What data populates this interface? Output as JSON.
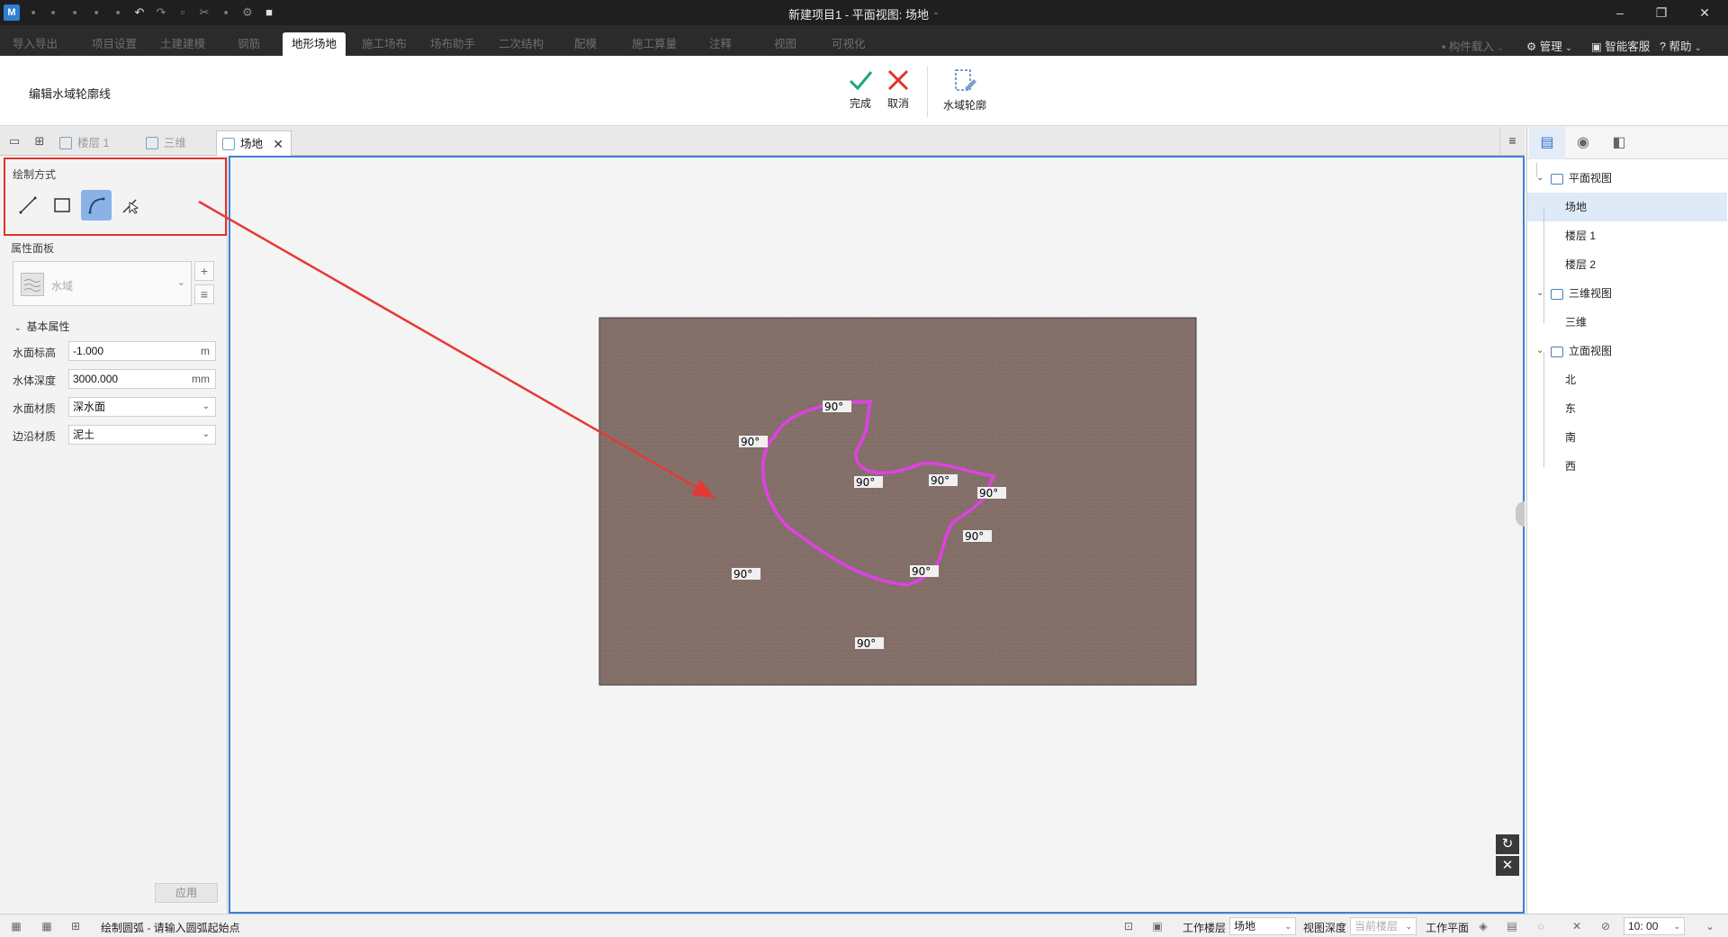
{
  "window": {
    "app_logo": "M",
    "title": "新建项目1 - 平面视图: 场地",
    "title_arrow": "⌃",
    "minimize": "–",
    "restore": "❐",
    "close": "✕"
  },
  "ribbon_tabs": [
    {
      "label": "导入导出"
    },
    {
      "label": "项目设置"
    },
    {
      "label": "土建建模"
    },
    {
      "label": "钢筋"
    },
    {
      "label": "地形场地"
    },
    {
      "label": "施工场布"
    },
    {
      "label": "场布助手"
    },
    {
      "label": "二次结构"
    },
    {
      "label": "配模"
    },
    {
      "label": "施工算量"
    },
    {
      "label": "注释"
    },
    {
      "label": "视图"
    },
    {
      "label": "可视化"
    }
  ],
  "ribbon_right": {
    "component_load": "构件载入",
    "manage": "管理",
    "smart_service": "智能客服",
    "help": "帮助"
  },
  "ribbon": {
    "mode_label": "编辑水域轮廓线",
    "finish": "完成",
    "cancel": "取消",
    "water_outline": "水域轮廓"
  },
  "view_tabs": [
    {
      "label": "楼层 1"
    },
    {
      "label": "三维"
    },
    {
      "label": "场地",
      "close": "✕"
    }
  ],
  "view_menu": "≡",
  "draw_mode": {
    "header": "绘制方式",
    "tools": [
      "line-tool",
      "rectangle-tool",
      "arc-tool",
      "pick-tool"
    ],
    "active_tool": "arc-tool"
  },
  "properties": {
    "header": "属性面板",
    "type_name": "水域",
    "add": "+",
    "edit": "≡",
    "group": "基本属性",
    "rows": [
      {
        "label": "水面标高",
        "value": "-1.000",
        "unit": "m"
      },
      {
        "label": "水体深度",
        "value": "3000.000",
        "unit": "mm"
      },
      {
        "label": "水面材质",
        "value": "深水面"
      },
      {
        "label": "边沿材质",
        "value": "泥土"
      }
    ],
    "apply": "应用"
  },
  "canvas": {
    "angle_labels": [
      "90°",
      "90°",
      "90°",
      "90°",
      "90°",
      "90°",
      "90°",
      "90°",
      "90°",
      "90°"
    ],
    "site_color": "#85716a",
    "outline_color": "#e040e6",
    "annotation_color": "#e53935"
  },
  "project_tree": {
    "tabs": [
      "project-view-icon",
      "visibility-icon",
      "layout-icon"
    ],
    "groups": [
      {
        "label": "平面视图",
        "items": [
          "场地",
          "楼层 1",
          "楼层 2"
        ]
      },
      {
        "label": "三维视图",
        "items": [
          "三维"
        ]
      },
      {
        "label": "立面视图",
        "items": [
          "北",
          "东",
          "南",
          "西"
        ]
      }
    ],
    "selected": "场地"
  },
  "status": {
    "prompt": "绘制圆弧 - 请输入圆弧起始点",
    "work_floor_label": "工作楼层",
    "work_floor_value": "场地",
    "view_depth_label": "视图深度",
    "view_depth_value": "当前楼层",
    "work_plane_label": "工作平面",
    "scale_value": "10: 00"
  }
}
